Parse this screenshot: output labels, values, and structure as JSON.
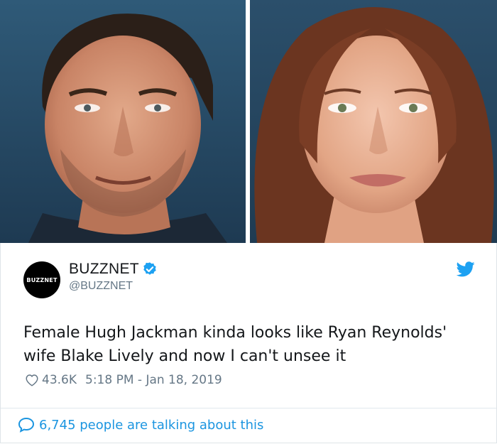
{
  "images": {
    "left": {
      "alt": "portrait-man"
    },
    "right": {
      "alt": "portrait-woman"
    }
  },
  "tweet": {
    "avatar_text": "BUZZNET",
    "display_name": "BUZZNET",
    "handle": "@BUZZNET",
    "text": "Female Hugh Jackman kinda looks like Ryan Reynolds' wife Blake Lively and now I can't unsee it",
    "likes": "43.6K",
    "timestamp": "5:18 PM - Jan 18, 2019",
    "talking": "6,745 people are talking about this"
  },
  "colors": {
    "accent": "#1b95e0",
    "verified": "#1da1f2",
    "muted": "#657786",
    "text": "#14171a",
    "photo_bg": "#27475f"
  },
  "icons": {
    "verified": "verified-badge-icon",
    "brand": "twitter-bird-icon",
    "like": "heart-icon",
    "reply": "speech-bubble-icon"
  }
}
